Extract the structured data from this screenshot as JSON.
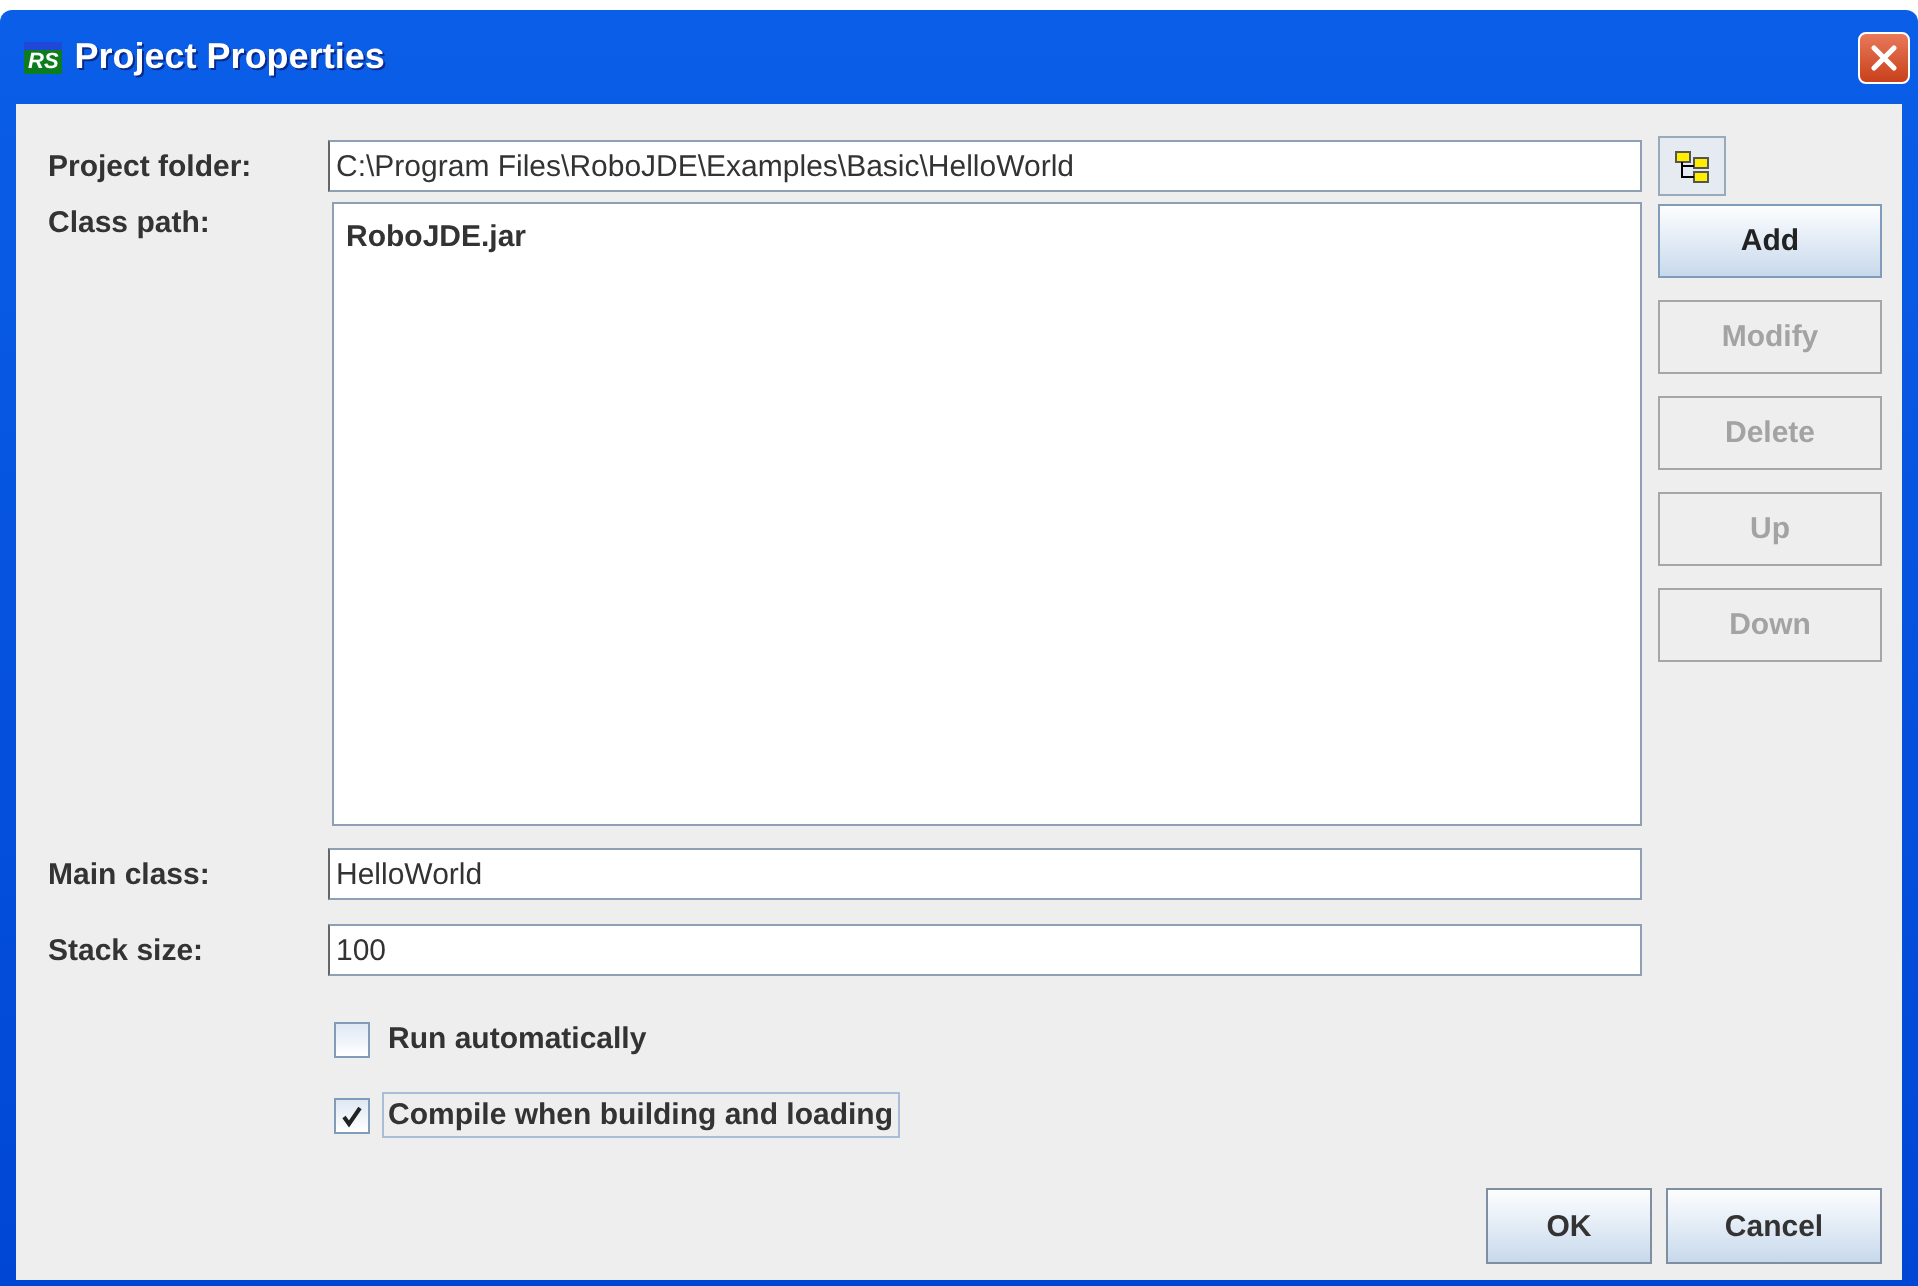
{
  "window": {
    "title": "Project Properties",
    "logo": "RS"
  },
  "project_folder": {
    "label": "Project folder:",
    "value": "C:\\Program Files\\RoboJDE\\Examples\\Basic\\HelloWorld"
  },
  "class_path": {
    "label": "Class path:",
    "entries": [
      {
        "text": "RoboJDE.jar",
        "selected": false
      }
    ]
  },
  "class_path_buttons": [
    {
      "label": "Add",
      "disabled": false
    },
    {
      "label": "Modify",
      "disabled": true
    },
    {
      "label": "Delete",
      "disabled": true
    },
    {
      "label": "Up",
      "disabled": true
    },
    {
      "label": "Down",
      "disabled": true
    }
  ],
  "main_class": {
    "label": "Main class:",
    "value": "HelloWorld"
  },
  "stack_size": {
    "label": "Stack size:",
    "value": "100"
  },
  "options": [
    {
      "label": "Run automatically",
      "checked": false,
      "focused": false
    },
    {
      "label": "Compile when building and loading",
      "checked": true,
      "focused": true
    }
  ],
  "buttons": [
    "OK",
    "Cancel"
  ]
}
